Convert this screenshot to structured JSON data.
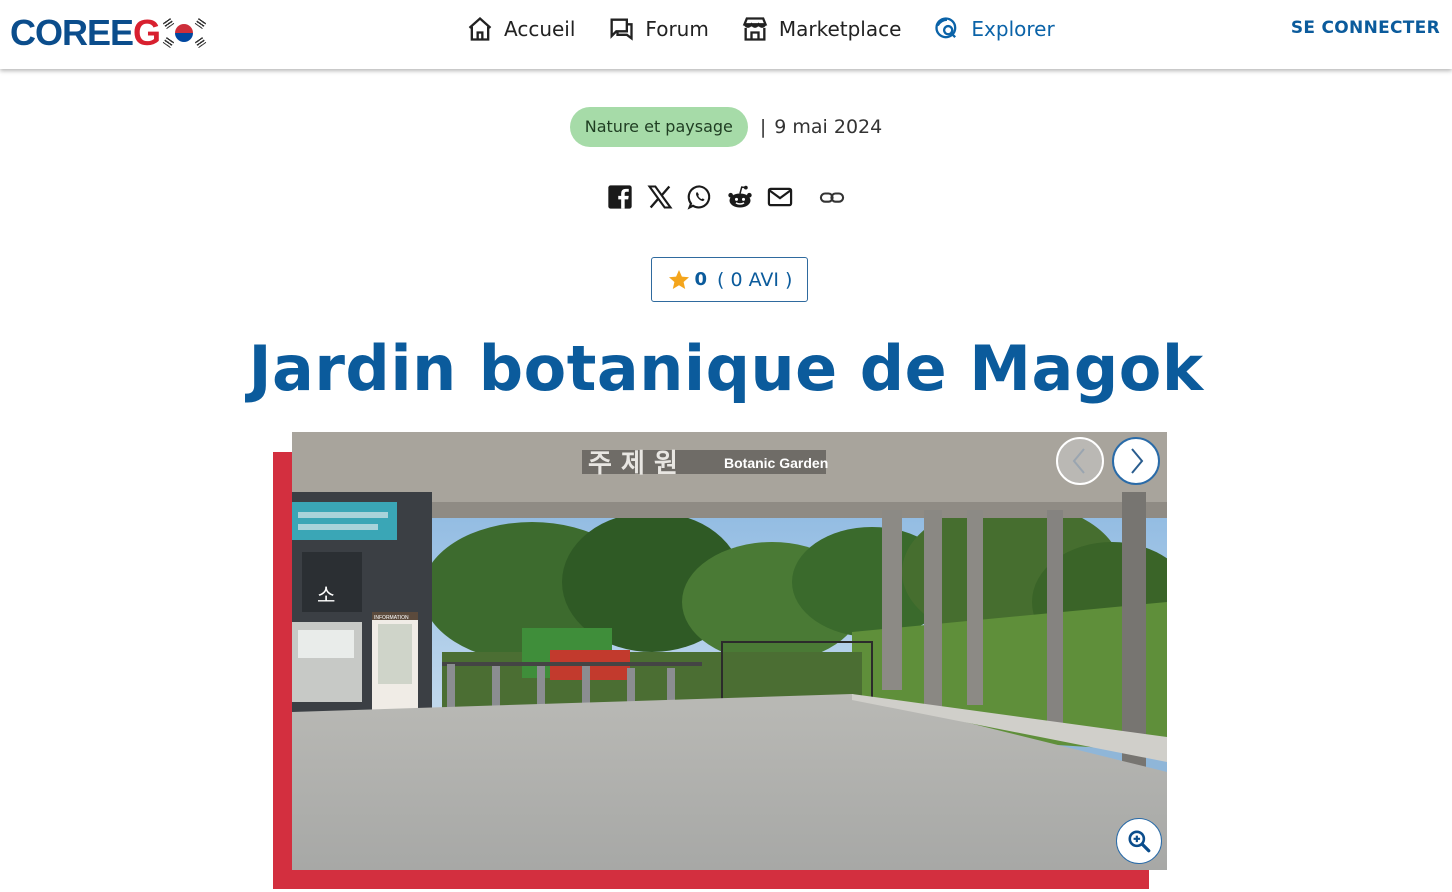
{
  "header": {
    "logo_text_main": "COREE",
    "logo_text_accent": "G",
    "nav": [
      {
        "label": "Accueil",
        "icon": "home-icon"
      },
      {
        "label": "Forum",
        "icon": "forum-icon"
      },
      {
        "label": "Marketplace",
        "icon": "store-icon"
      },
      {
        "label": "Explorer",
        "icon": "explore-icon"
      }
    ],
    "login_label": "SE CONNECTER"
  },
  "article": {
    "category": "Nature et paysage",
    "separator": "|",
    "date": "9 mai 2024",
    "share": [
      "facebook-icon",
      "x-icon",
      "whatsapp-icon",
      "reddit-icon",
      "email-icon",
      "link-icon"
    ],
    "rating": {
      "score": "0",
      "count_label": "( 0 AVI )"
    },
    "title": "Jardin botanique de Magok"
  },
  "gallery": {
    "sign_korean": "주 제 원",
    "sign_english": "Botanic Garden",
    "kiosk_char": "소",
    "info_label": "INFORMATION"
  },
  "colors": {
    "brand_blue": "#0b5b9c",
    "brand_red": "#d32f3f",
    "badge_green": "#a6dba8",
    "star": "#f4a51c"
  }
}
